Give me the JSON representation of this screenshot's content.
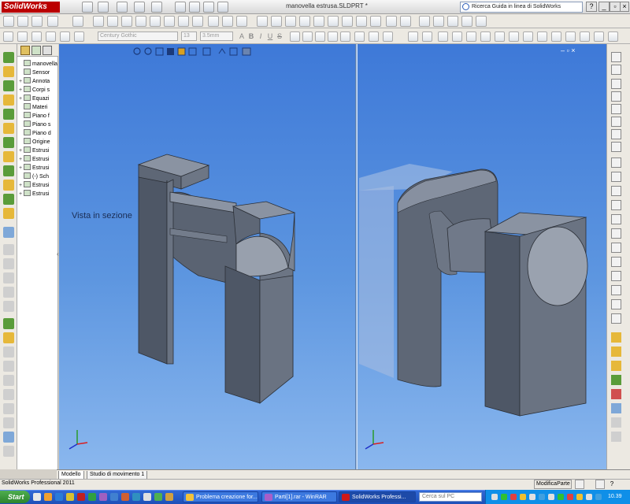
{
  "app": {
    "logo": "SolidWorks",
    "doc_title": "manovella estrusa.SLDPRT *",
    "help_search": "Ricerca Guida in linea di SolidWorks"
  },
  "format_bar": {
    "font": "Century Gothic",
    "size": "13",
    "height": "3.5mm",
    "fmt_buttons": [
      "A",
      "B",
      "I",
      "U",
      "S"
    ]
  },
  "feature_tree": {
    "items": [
      {
        "label": "manovella",
        "expand": ""
      },
      {
        "label": "Sensor",
        "expand": ""
      },
      {
        "label": "Annota",
        "expand": "+"
      },
      {
        "label": "Corpi s",
        "expand": "+"
      },
      {
        "label": "Equazi",
        "expand": "+"
      },
      {
        "label": "Materi",
        "expand": ""
      },
      {
        "label": "Piano f",
        "expand": ""
      },
      {
        "label": "Piano s",
        "expand": ""
      },
      {
        "label": "Piano d",
        "expand": ""
      },
      {
        "label": "Origine",
        "expand": ""
      },
      {
        "label": "Estrusi",
        "expand": "+"
      },
      {
        "label": "Estrusi",
        "expand": "+"
      },
      {
        "label": "Estrusi",
        "expand": "+"
      },
      {
        "label": "(-) Sch",
        "expand": ""
      },
      {
        "label": "Estrusi",
        "expand": "+"
      },
      {
        "label": "Estrusi",
        "expand": "+"
      }
    ]
  },
  "viewport": {
    "section_label": "Vista in sezione",
    "right_controls": "– ▫ ×"
  },
  "tabs": [
    {
      "label": "Modello"
    },
    {
      "label": "Studio di movimento 1"
    }
  ],
  "statusbar": {
    "left": "SolidWorks Professional 2011",
    "right": "ModificaParte"
  },
  "taskbar": {
    "start": "Start",
    "tasks": [
      {
        "label": "Problema creazione for...",
        "color": "#f3c23a"
      },
      {
        "label": "Parti[1].rar - WinRAR",
        "color": "#a85ec8"
      },
      {
        "label": "SolidWorks Professi...",
        "color": "#d01818"
      }
    ],
    "search": "Cerca sul PC",
    "clock": "10.39"
  },
  "colors": {
    "viewport_top": "#3e79d8",
    "viewport_bottom": "#8ab7ee",
    "part": "#626b7a"
  },
  "icons": {
    "help": "search-icon",
    "start": "windows-icon"
  }
}
